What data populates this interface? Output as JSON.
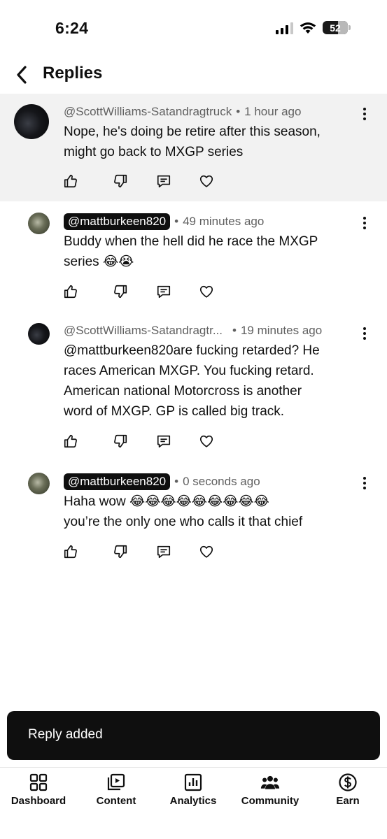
{
  "status_bar": {
    "time": "6:24",
    "battery": "52"
  },
  "header": {
    "title": "Replies",
    "back_icon": "chevron-left-icon"
  },
  "comments": [
    {
      "handle": "@ScottWilliams-Satandragtruck",
      "time": "1 hour ago",
      "text_lines": [
        "Nope, he's doing be retire after this season,",
        "might go back to MXGP series"
      ]
    },
    {
      "handle": "@mattburkeen820",
      "time": "49 minutes ago",
      "text_lines": [
        "Buddy when the hell did he race the MXGP",
        "series 😂😭"
      ]
    },
    {
      "handle": "@ScottWilliams-Satandragtr...",
      "time": "19 minutes ago",
      "text_lines": [
        "@mattburkeen820are fucking retarded? He",
        "races American MXGP. You fucking retard.",
        "American national Motorcross is another",
        "word of MXGP. GP is called big track."
      ]
    },
    {
      "handle": "@mattburkeen820",
      "time": "0 seconds ago",
      "text_lines": [
        "Haha wow 😂😂😂😂😂😂😂😂😂",
        "you’re the only one who calls it that chief"
      ]
    }
  ],
  "separator": "•",
  "toast": {
    "text": "Reply added"
  },
  "bottom_nav": {
    "items": [
      {
        "label": "Dashboard",
        "icon": "dashboard-icon"
      },
      {
        "label": "Content",
        "icon": "content-play-icon"
      },
      {
        "label": "Analytics",
        "icon": "analytics-chart-icon"
      },
      {
        "label": "Community",
        "icon": "community-people-icon"
      },
      {
        "label": "Earn",
        "icon": "dollar-icon"
      }
    ]
  }
}
